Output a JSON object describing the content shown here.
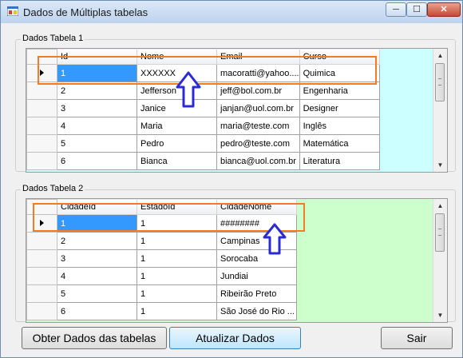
{
  "window": {
    "title": "Dados de Múltiplas tabelas",
    "min_glyph": "─",
    "max_glyph": "☐",
    "close_glyph": "✕"
  },
  "group1": {
    "label": "Dados Tabela 1",
    "columns": [
      "Id",
      "Nome",
      "Email",
      "Curso"
    ],
    "rows": [
      [
        "1",
        "XXXXXX",
        "macoratti@yahoo....",
        "Quimica"
      ],
      [
        "2",
        "Jefferson",
        "jeff@bol.com.br",
        "Engenharia"
      ],
      [
        "3",
        "Janice",
        "janjan@uol.com.br",
        "Designer"
      ],
      [
        "4",
        "Maria",
        "maria@teste.com",
        "Inglês"
      ],
      [
        "5",
        "Pedro",
        "pedro@teste.com",
        "Matemática"
      ],
      [
        "6",
        "Bianca",
        "bianca@uol.com.br",
        "Literatura"
      ]
    ]
  },
  "group2": {
    "label": "Dados Tabela 2",
    "columns": [
      "CidadeId",
      "EstadoId",
      "CidadeNome"
    ],
    "rows": [
      [
        "1",
        "1",
        "########"
      ],
      [
        "2",
        "1",
        "Campinas"
      ],
      [
        "3",
        "1",
        "Sorocaba"
      ],
      [
        "4",
        "1",
        "Jundiai"
      ],
      [
        "5",
        "1",
        "Ribeirão Preto"
      ],
      [
        "6",
        "1",
        "São José do Rio ..."
      ]
    ]
  },
  "buttons": {
    "obter": "Obter Dados das tabelas",
    "atualizar": "Atualizar Dados",
    "sair": "Sair"
  },
  "colors": {
    "highlight": "#f47b20",
    "arrow": "#2b2bd6",
    "grid1_bg": "#ccffff",
    "grid2_bg": "#ccffcc",
    "selection": "#3399ff"
  }
}
